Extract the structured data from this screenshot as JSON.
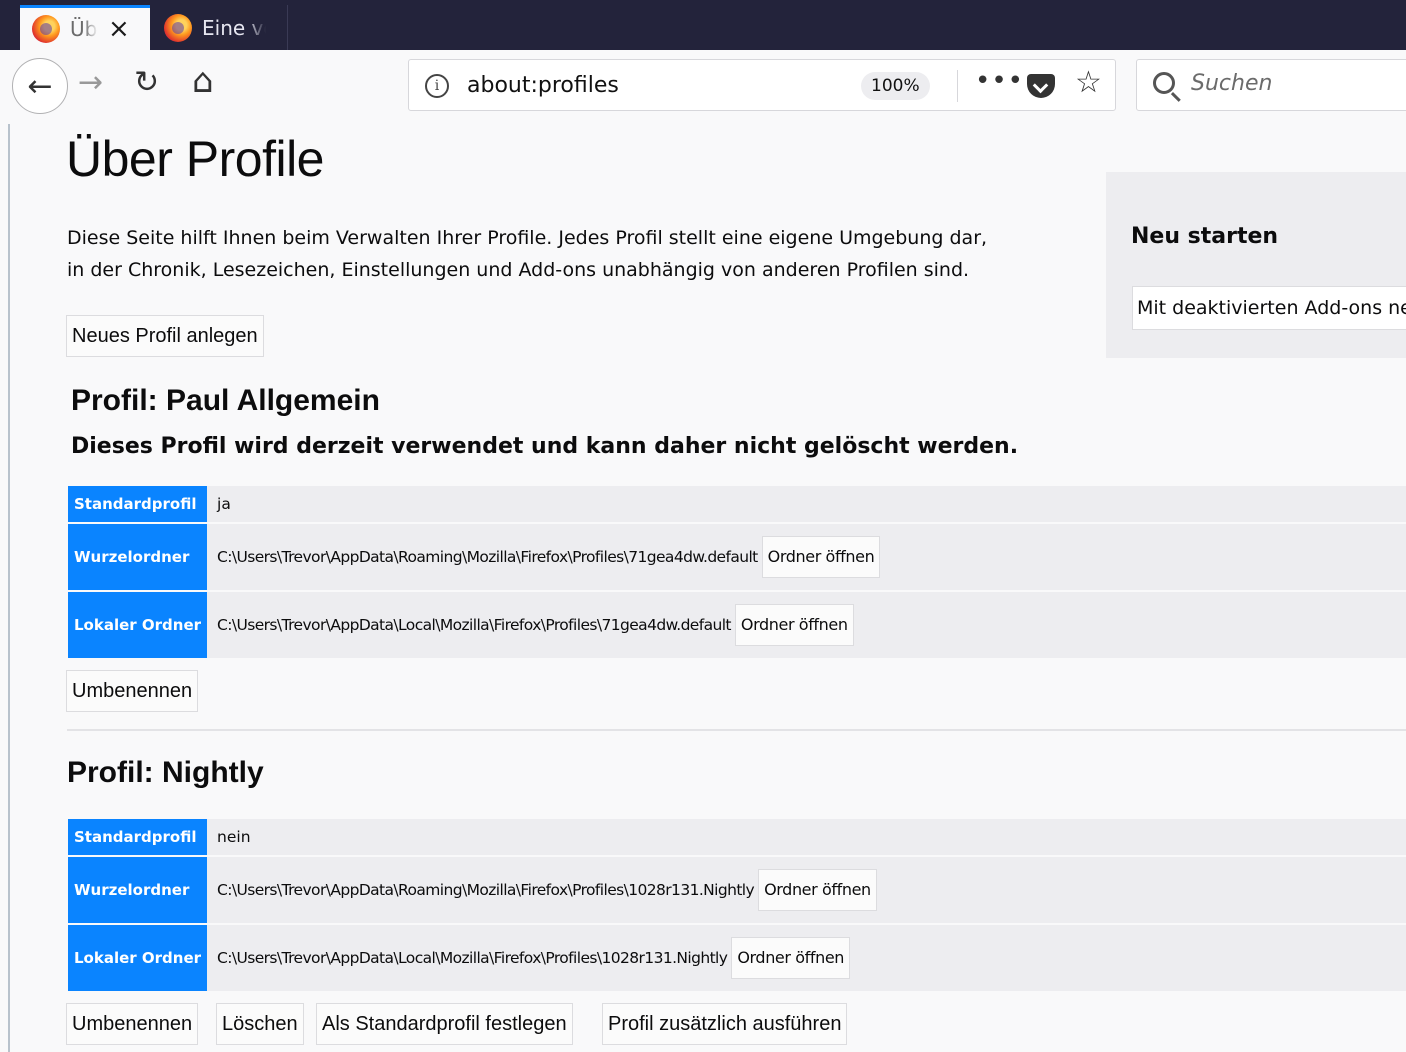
{
  "browser": {
    "tabs": [
      {
        "label": "Über Profile",
        "active": true
      },
      {
        "label": "Eine vorgestellte Seite",
        "active": false
      }
    ],
    "url": "about:profiles",
    "zoom": "100%",
    "search_placeholder": "Suchen"
  },
  "icons": {
    "close": "×",
    "back": "←",
    "forward": "→",
    "reload": "↻",
    "home": "⌂",
    "info": "i",
    "more": "•••",
    "star": "☆"
  },
  "page": {
    "title": "Über Profile",
    "intro": "Diese Seite hilft Ihnen beim Verwalten Ihrer Profile. Jedes Profil stellt eine eigene Umgebung dar, in der Chronik, Lesezeichen, Einstellungen und Add-ons unabhängig von anderen Profilen sind.",
    "new_profile_button": "Neues Profil anlegen"
  },
  "restart_panel": {
    "title": "Neu starten",
    "button": "Mit deaktivierten Add-ons neu starten…"
  },
  "labels": {
    "default": "Standardprofil",
    "root": "Wurzelordner",
    "local": "Lokaler Ordner",
    "open_folder": "Ordner öffnen"
  },
  "profiles": [
    {
      "title": "Profil: Paul Allgemein",
      "in_use_warning": "Dieses Profil wird derzeit verwendet und kann daher nicht gelöscht werden.",
      "default_value": "ja",
      "root_path": "C:\\Users\\Trevor\\AppData\\Roaming\\Mozilla\\Firefox\\Profiles\\71gea4dw.default",
      "local_path": "C:\\Users\\Trevor\\AppData\\Local\\Mozilla\\Firefox\\Profiles\\71gea4dw.default",
      "buttons": [
        "Umbenennen"
      ]
    },
    {
      "title": "Profil: Nightly",
      "default_value": "nein",
      "root_path": "C:\\Users\\Trevor\\AppData\\Roaming\\Mozilla\\Firefox\\Profiles\\1028r131.Nightly",
      "local_path": "C:\\Users\\Trevor\\AppData\\Local\\Mozilla\\Firefox\\Profiles\\1028r131.Nightly",
      "buttons": [
        "Umbenennen",
        "Löschen",
        "Als Standardprofil festlegen",
        "Profil zusätzlich ausführen"
      ]
    }
  ],
  "colors": {
    "accent": "#0a84ff",
    "tabbar": "#23233b",
    "row_bg": "#ededf0"
  }
}
